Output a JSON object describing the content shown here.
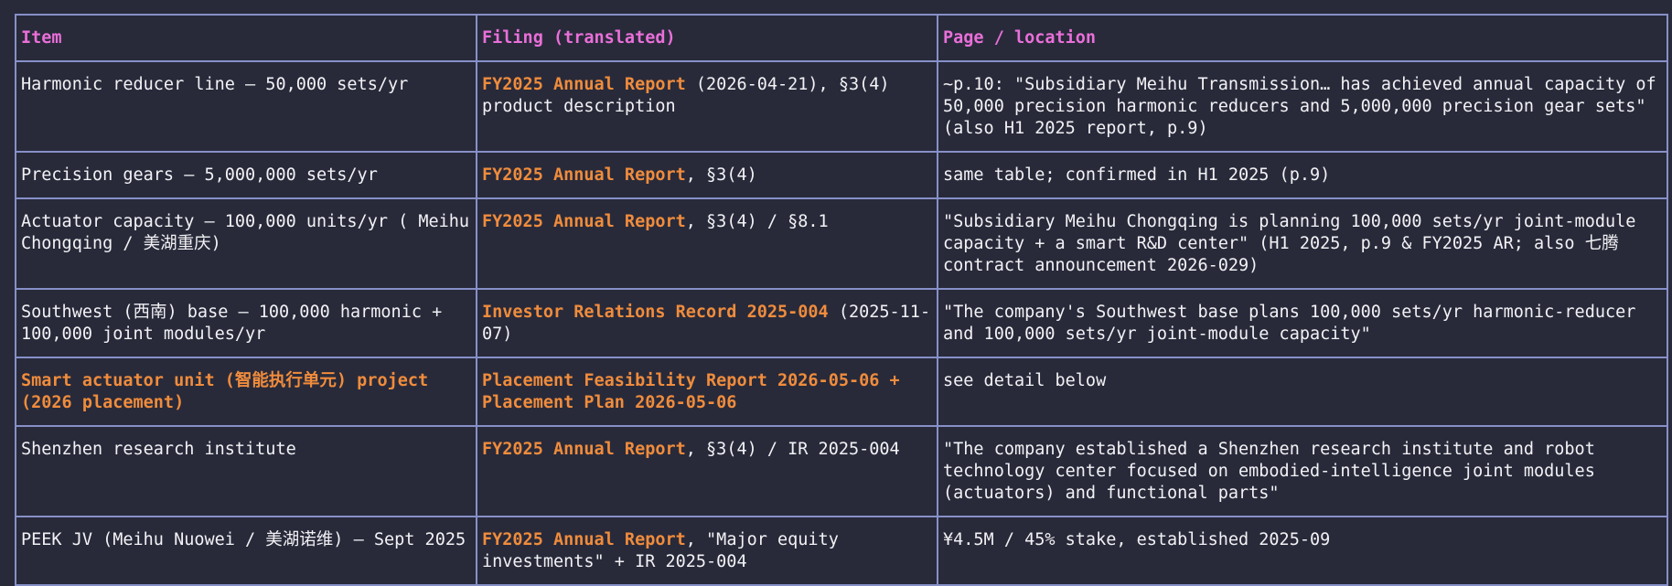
{
  "table": {
    "headers": [
      "Item",
      "Filing (translated)",
      "Page / location"
    ],
    "rows": [
      {
        "item": "Harmonic reducer line — 50,000 sets/yr",
        "filing_hl": "FY2025 Annual Report",
        "filing_rest": " (2026-04-21), §3(4) product description",
        "location": "~p.10: \"Subsidiary Meihu Transmission… has achieved annual capacity of 50,000 precision harmonic reducers and 5,000,000 precision gear sets\" (also H1 2025 report, p.9)"
      },
      {
        "item": "Precision gears — 5,000,000 sets/yr",
        "filing_hl": "FY2025 Annual Report",
        "filing_rest": ", §3(4)",
        "location": "same table; confirmed in H1 2025 (p.9)"
      },
      {
        "item": "Actuator capacity — 100,000 units/yr ( Meihu Chongqing / 美湖重庆)",
        "filing_hl": "FY2025 Annual Report",
        "filing_rest": ", §3(4) / §8.1",
        "location": "\"Subsidiary Meihu Chongqing is planning 100,000 sets/yr joint-module capacity + a smart R&D center\" (H1 2025, p.9 & FY2025 AR; also 七腾 contract announcement 2026-029)"
      },
      {
        "item": "Southwest (西南) base — 100,000 harmonic + 100,000 joint modules/yr",
        "filing_hl": "Investor Relations Record 2025-004",
        "filing_rest": " (2025-11-07)",
        "location": "\"The company's Southwest base plans 100,000 sets/yr harmonic-reducer and 100,000 sets/yr joint-module capacity\""
      },
      {
        "item": "Smart actuator unit (智能执行单元) project (2026 placement)",
        "item_highlight": true,
        "filing_hl": "Placement Feasibility Report 2026-05-06 + Placement Plan 2026-05-06",
        "filing_rest": "",
        "location": "see detail below"
      },
      {
        "item": "Shenzhen research institute",
        "filing_hl": "FY2025 Annual Report",
        "filing_rest": ", §3(4) / IR 2025-004",
        "location": "\"The company established a Shenzhen research institute and robot technology center focused on embodied-intelligence joint modules (actuators) and functional parts\""
      },
      {
        "item": "PEEK JV (Meihu Nuowei / 美湖诺维) — Sept 2025",
        "filing_hl": "FY2025 Annual Report",
        "filing_rest": ", \"Major equity investments\" + IR 2025-004",
        "location": "¥4.5M / 45% stake, established 2025-09"
      }
    ]
  },
  "colors": {
    "background": "#282a3a",
    "border": "#8790c8",
    "header_text": "#ea6fd9",
    "highlight_text": "#f08c3c",
    "body_text": "#f2f2f5"
  }
}
